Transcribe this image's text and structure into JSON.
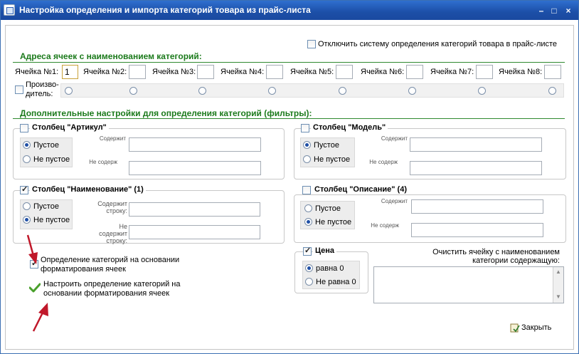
{
  "window": {
    "title": "Настройка определения и импорта категорий товара из прайс-листа"
  },
  "disable_system": {
    "label": "Отключить систему определения категорий товара в прайс-листе"
  },
  "cells": {
    "heading": "Адреса ячеек с наименованием категорий:",
    "items": [
      {
        "label": "Ячейка №1:",
        "value": "1"
      },
      {
        "label": "Ячейка №2:",
        "value": ""
      },
      {
        "label": "Ячейка №3:",
        "value": ""
      },
      {
        "label": "Ячейка №4:",
        "value": ""
      },
      {
        "label": "Ячейка №5:",
        "value": ""
      },
      {
        "label": "Ячейка №6:",
        "value": ""
      },
      {
        "label": "Ячейка №7:",
        "value": ""
      },
      {
        "label": "Ячейка №8:",
        "value": ""
      }
    ],
    "manufacturer_line1": "Произво-",
    "manufacturer_line2": "дитель:"
  },
  "filters": {
    "heading": "Дополнительные настройки для определения категорий (фильтры):",
    "article": {
      "title": "Столбец \"Артикул\"",
      "opt_empty": "Пустое",
      "opt_not_empty": "Не пустое",
      "contains": "Содержит",
      "not_contains": "Не содерж"
    },
    "model": {
      "title": "Столбец \"Модель\"",
      "opt_empty": "Пустое",
      "opt_not_empty": "Не пустое",
      "contains": "Содержит",
      "not_contains": "Не содерж"
    },
    "name": {
      "title": "Столбец \"Наименование\" (1)",
      "opt_empty": "Пустое",
      "opt_not_empty": "Не пустое",
      "contains_l1": "Содержит",
      "contains_l2": "строку:",
      "not_l1": "Не",
      "not_l2": "содержит",
      "not_l3": "строку:"
    },
    "description": {
      "title": "Столбец \"Описание\" (4)",
      "opt_empty": "Пустое",
      "opt_not_empty": "Не пустое",
      "contains": "Содержит",
      "not_contains": "Не содерж"
    }
  },
  "format_detection": {
    "label_l1": "Определение категорий на основании",
    "label_l2": "форматирования ячеек"
  },
  "configure_link": {
    "label_l1": "Настроить определение категорий на",
    "label_l2": "основании форматирования ячеек"
  },
  "price": {
    "title": "Цена",
    "opt_zero": "равна 0",
    "opt_nonzero": "Не равна 0"
  },
  "clear_cell": {
    "label_l1": "Очистить ячейку с наименованием",
    "label_l2": "категории содержащую:"
  },
  "close_button": {
    "label": "Закрыть"
  },
  "colors": {
    "accent": "#1b7a1b",
    "titlebar": "#1c4fa7",
    "arrow": "#c0182a"
  }
}
